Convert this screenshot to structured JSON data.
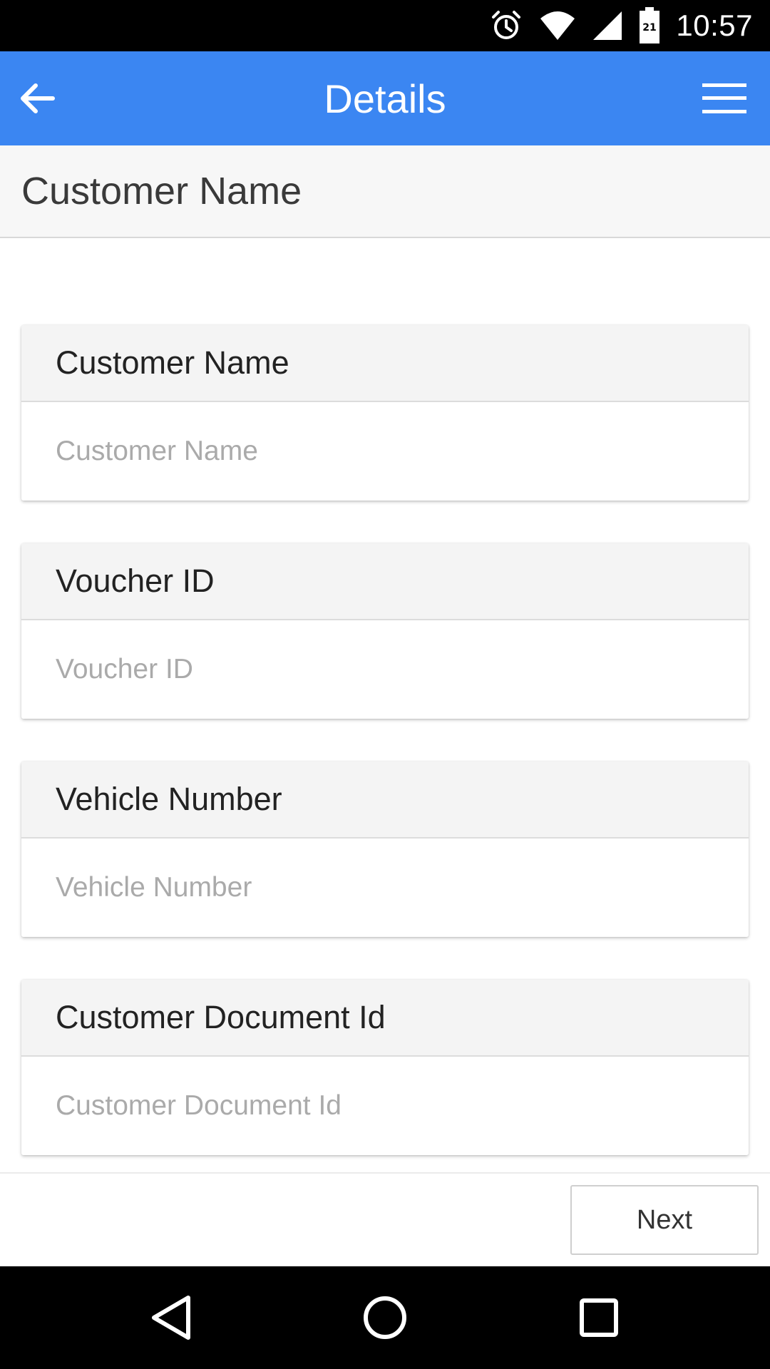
{
  "status_bar": {
    "time": "10:57",
    "battery_level_text": "21",
    "icons": [
      "alarm-icon",
      "wifi-icon",
      "cell-signal-icon",
      "battery-icon"
    ]
  },
  "app_bar": {
    "title": "Details",
    "left_icon": "back-arrow-icon",
    "right_icon": "hamburger-menu-icon",
    "color": "#3b86f2"
  },
  "section_header": {
    "title": "Customer Name"
  },
  "form": {
    "fields": [
      {
        "label": "Customer Name",
        "placeholder": "Customer Name",
        "value": ""
      },
      {
        "label": "Voucher ID",
        "placeholder": "Voucher ID",
        "value": ""
      },
      {
        "label": "Vehicle Number",
        "placeholder": "Vehicle Number",
        "value": ""
      },
      {
        "label": "Customer Document Id",
        "placeholder": "Customer Document Id",
        "value": ""
      }
    ]
  },
  "footer": {
    "next_label": "Next"
  },
  "nav_bar": {
    "icons": [
      "nav-back-icon",
      "nav-home-icon",
      "nav-recents-icon"
    ]
  }
}
